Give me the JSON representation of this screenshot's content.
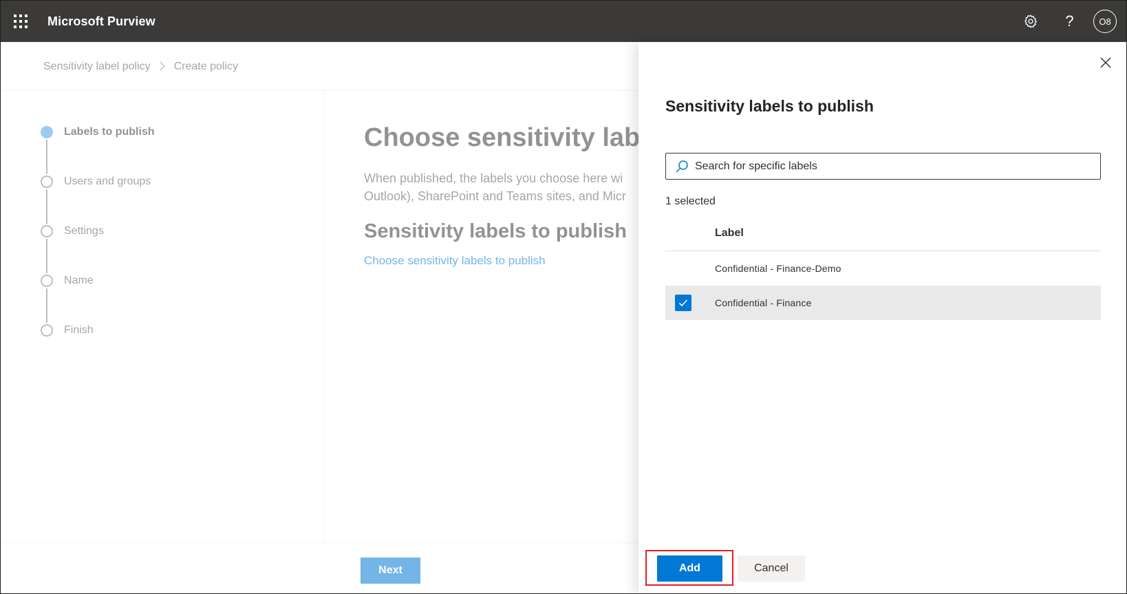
{
  "app": {
    "title": "Microsoft Purview",
    "waffle_icon": "app-launcher-icon",
    "settings_icon": "gear-icon",
    "help_icon": "?",
    "avatar_initials": "O8"
  },
  "breadcrumb": {
    "items": [
      "Sensitivity label policy",
      "Create policy"
    ],
    "separator": ">"
  },
  "wizard": {
    "steps": [
      {
        "label": "Labels to publish",
        "active": true
      },
      {
        "label": "Users and groups",
        "active": false
      },
      {
        "label": "Settings",
        "active": false
      },
      {
        "label": "Name",
        "active": false
      },
      {
        "label": "Finish",
        "active": false
      }
    ],
    "heading": "Choose sensitivity labe",
    "description_line1": "When published, the labels you choose here wi",
    "description_line2": "Outlook), SharePoint and Teams sites, and Micr",
    "subheading": "Sensitivity labels to publish",
    "link": "Choose sensitivity labels to publish",
    "next_label": "Next"
  },
  "panel": {
    "title": "Sensitivity labels to publish",
    "search_placeholder": "Search for specific labels",
    "selected_count": "1 selected",
    "column_header": "Label",
    "rows": [
      {
        "label": "Confidential - Finance-Demo",
        "checked": false
      },
      {
        "label": "Confidential - Finance",
        "checked": true
      }
    ],
    "add_label": "Add",
    "cancel_label": "Cancel"
  },
  "colors": {
    "topbar": "#3b3a39",
    "accent": "#0078d4",
    "highlight": "#e02020"
  }
}
